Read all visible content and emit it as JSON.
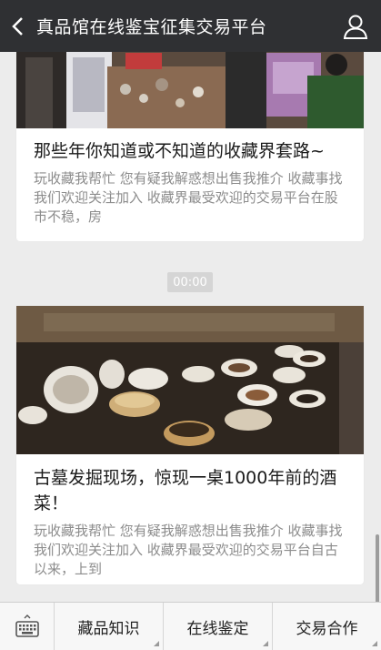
{
  "header": {
    "title": "真品馆在线鉴宝征集交易平台"
  },
  "articles": [
    {
      "title": "那些年你知道或不知道的收藏界套路~",
      "description": "玩收藏我帮忙  您有疑我解惑想出售我推介  收藏事找我们欢迎关注加入 收藏界最受欢迎的交易平台在股市不稳，房"
    },
    {
      "title": "古墓发掘现场，惊现一桌1000年前的酒菜！",
      "description": "玩收藏我帮忙  您有疑我解惑想出售我推介  收藏事找我们欢迎关注加入 收藏界最受欢迎的交易平台自古以来，上到"
    }
  ],
  "timestamp": "00:00",
  "menu": {
    "items": [
      "藏品知识",
      "在线鉴定",
      "交易合作"
    ]
  },
  "icons": {
    "back": "back-arrow-icon",
    "user": "user-icon",
    "keyboard": "keyboard-icon"
  },
  "colors": {
    "topbar": "#2f3033",
    "background": "#ececec",
    "timestamp_bg": "#d5d5d5"
  }
}
